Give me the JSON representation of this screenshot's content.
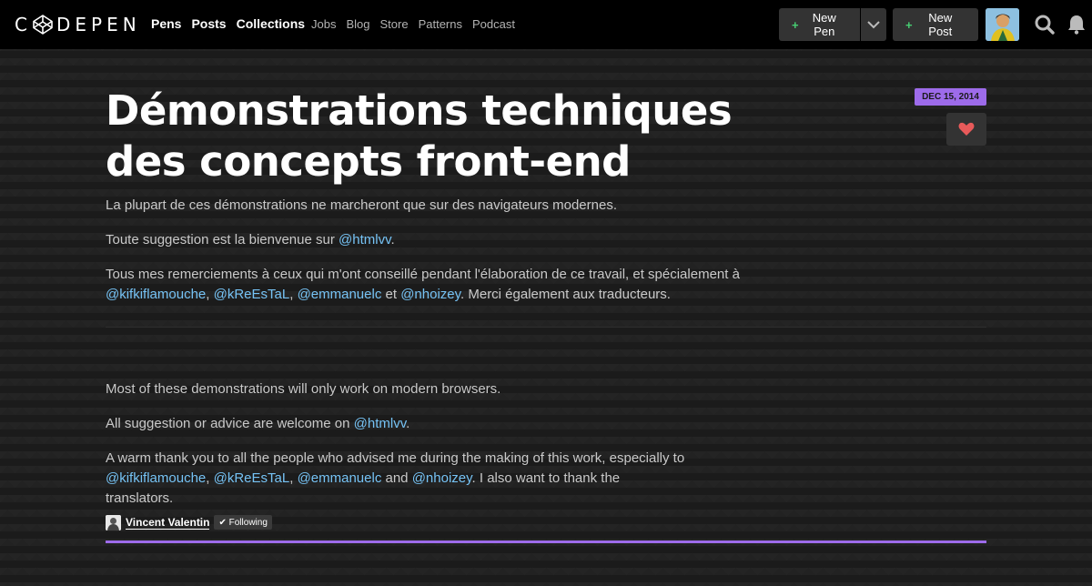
{
  "header": {
    "logo_text": "DEPEN",
    "nav_primary": [
      "Pens",
      "Posts",
      "Collections"
    ],
    "nav_secondary": [
      "Jobs",
      "Blog",
      "Store",
      "Patterns",
      "Podcast"
    ],
    "new_pen_label": "New Pen",
    "new_post_label": "New Post",
    "plus_symbol": "+"
  },
  "post": {
    "title": "Démonstrations techniques des concepts front-end",
    "date": "DEC 15, 2014",
    "fr": {
      "p1": "La plupart de ces démonstrations ne marcheront que sur des navigateurs modernes.",
      "p2_pre": "Toute suggestion est la bienvenue sur ",
      "p2_mention": "@htmlvv",
      "p2_post": ".",
      "p3_pre": "Tous mes remerciements à ceux qui m'ont conseillé pendant l'élaboration de ce travail, et spécialement à ",
      "p3_m1": "@kifkiflamouche",
      "p3_sep1": ", ",
      "p3_m2": "@kReEsTaL",
      "p3_sep2": ", ",
      "p3_m3": "@emmanuelc",
      "p3_sep3": " et ",
      "p3_m4": "@nhoizey",
      "p3_post": ". Merci également aux traducteurs."
    },
    "en": {
      "p1": "Most of these demonstrations will only work on modern browsers.",
      "p2_pre": "All suggestion or advice are welcome on ",
      "p2_mention": "@htmlvv",
      "p2_post": ".",
      "p3_pre": "A warm thank you to all the people who advised me during the making of this work, especially to ",
      "p3_m1": "@kifkiflamouche",
      "p3_sep1": ", ",
      "p3_m2": "@kReEsTaL",
      "p3_sep2": ", ",
      "p3_m3": "@emmanuelc",
      "p3_sep3": " and ",
      "p3_m4": "@nhoizey",
      "p3_post": ". I also want to thank the translators."
    },
    "author_name": "Vincent Valentin",
    "following_label": "✔ Following"
  },
  "colors": {
    "accent_purple": "#9d6bea",
    "mention_blue": "#76c3f5",
    "plus_green": "#47cf73",
    "heart_red": "#e85a5a"
  }
}
